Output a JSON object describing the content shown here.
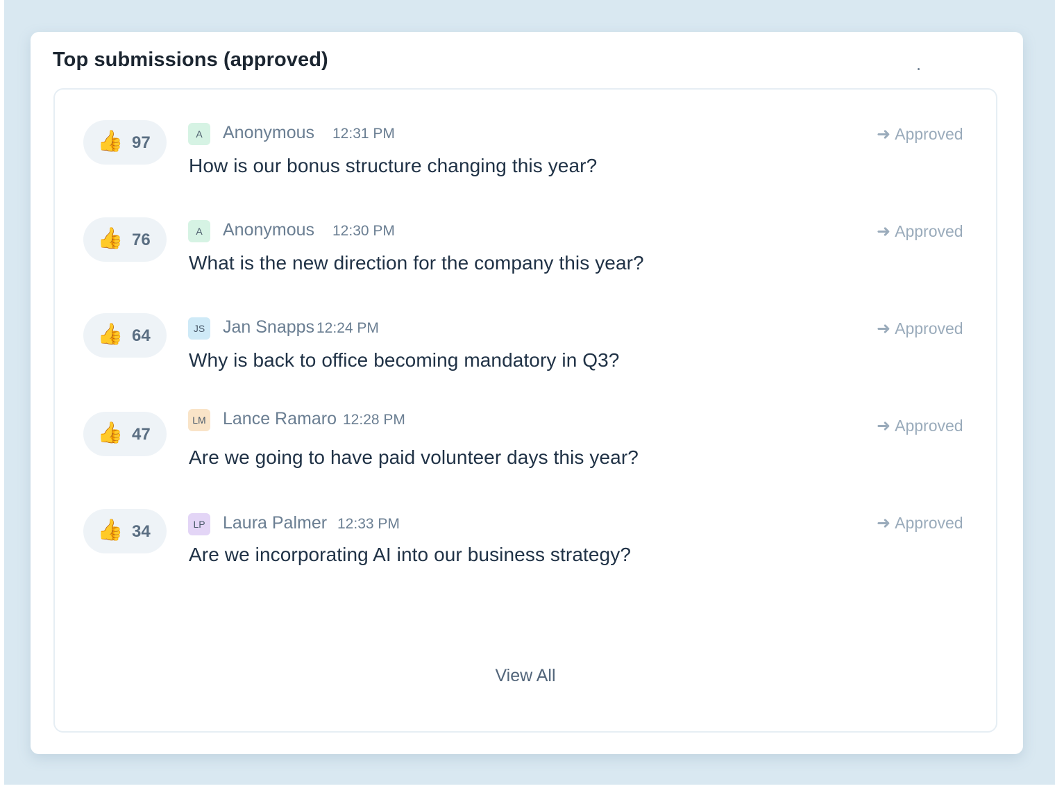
{
  "card": {
    "title": "Top submissions (approved)"
  },
  "submissions": [
    {
      "votes": "97",
      "avatar_initials": "A",
      "avatar_color": "#d6f3e4",
      "author": "Anonymous",
      "time": "12:31 PM",
      "question": "How is our bonus structure changing this year?",
      "status": "Approved"
    },
    {
      "votes": "76",
      "avatar_initials": "A",
      "avatar_color": "#d6f3e4",
      "author": "Anonymous",
      "time": "12:30 PM",
      "question": "What is the new direction for the company this year?",
      "status": "Approved"
    },
    {
      "votes": "64",
      "avatar_initials": "JS",
      "avatar_color": "#cfeaf7",
      "author": "Jan Snapps",
      "time": "12:24 PM",
      "question": "Why is back to office becoming mandatory in Q3?",
      "status": "Approved"
    },
    {
      "votes": "47",
      "avatar_initials": "LM",
      "avatar_color": "#f9e4c8",
      "author": "Lance Ramaro",
      "time": "12:28 PM",
      "question": "Are we going to have paid volunteer days this year?",
      "status": "Approved"
    },
    {
      "votes": "34",
      "avatar_initials": "LP",
      "avatar_color": "#e3d5f6",
      "author": "Laura Palmer",
      "time": "12:33 PM",
      "question": "Are we incorporating AI into our business strategy?",
      "status": "Approved"
    }
  ],
  "footer": {
    "view_all_label": "View All"
  },
  "icons": {
    "vote": "thumbs-up-icon",
    "status": "arrow-right-icon"
  },
  "colors": {
    "background": "#d9e8f1",
    "text_primary": "#203246",
    "text_muted": "#6a7e92",
    "status": "#9aabbb"
  }
}
